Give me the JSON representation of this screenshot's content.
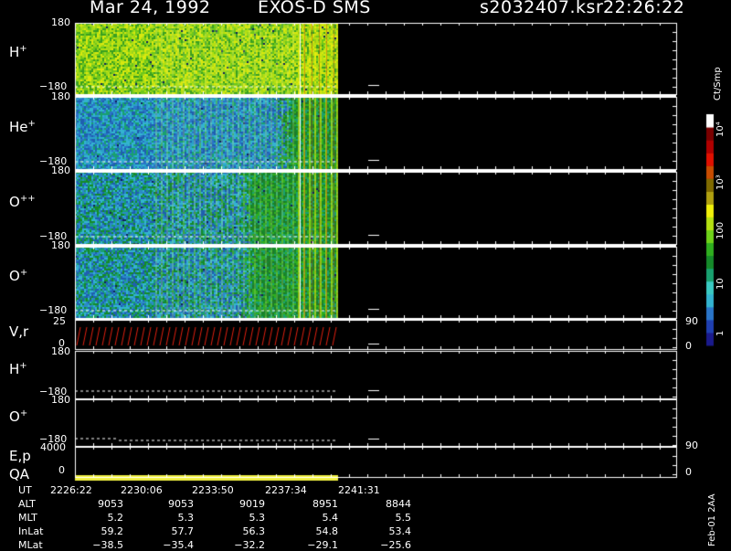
{
  "header": {
    "date": "Mar 24, 1992",
    "mission": "EXOS-D SMS",
    "file": "s2032407.ksr",
    "time": "22:26:22"
  },
  "panels": [
    {
      "id": "h",
      "label": "H",
      "sup": "+",
      "ytop": "180",
      "ybottom": "−180"
    },
    {
      "id": "he",
      "label": "He",
      "sup": "+",
      "ytop": "180",
      "ybottom": "−180"
    },
    {
      "id": "opp",
      "label": "O",
      "sup": "++",
      "ytop": "180",
      "ybottom": "−180"
    },
    {
      "id": "op",
      "label": "O",
      "sup": "+",
      "ytop": "180",
      "ybottom": "−180"
    },
    {
      "id": "vr",
      "label": "V,r",
      "sup": "",
      "ytop": "25",
      "ybottom": "0",
      "right_top": "90",
      "right_bottom": "0"
    },
    {
      "id": "h2",
      "label": "H",
      "sup": "+",
      "ytop": "180",
      "ybottom": "−180"
    },
    {
      "id": "o2",
      "label": "O",
      "sup": "+",
      "ytop": "180",
      "ybottom": "−180"
    },
    {
      "id": "ep",
      "label": "E,p",
      "sup": "",
      "ytop": "4000",
      "ybottom": "0",
      "right_top": "90",
      "right_bottom": "0"
    }
  ],
  "qa_label": "QA",
  "colorbar": {
    "unit": "Ct/Smp",
    "ticks": [
      {
        "label": "10⁴",
        "level": 1.0
      },
      {
        "label": "10³",
        "level": 0.75
      },
      {
        "label": "100",
        "level": 0.5
      },
      {
        "label": "10",
        "level": 0.25
      },
      {
        "label": "1",
        "level": 0.0
      }
    ],
    "colors": [
      "#1a1a8c",
      "#1f3fb0",
      "#2a75c8",
      "#33b3d0",
      "#3ac9c2",
      "#19a070",
      "#158a2a",
      "#2fae1f",
      "#6fd21a",
      "#b4e012",
      "#f0f00a",
      "#b0a010",
      "#806b00",
      "#c84c00",
      "#e01000",
      "#b00000",
      "#7a0000",
      "#ffffff"
    ]
  },
  "footer_table": {
    "rows": [
      {
        "label": "UT",
        "values": [
          "2226:22",
          "2230:06",
          "2233:50",
          "2237:34",
          "2241:31"
        ]
      },
      {
        "label": "ALT",
        "values": [
          "9053",
          "9053",
          "9019",
          "8951",
          "8844"
        ]
      },
      {
        "label": "MLT",
        "values": [
          "5.2",
          "5.3",
          "5.3",
          "5.4",
          "5.5"
        ]
      },
      {
        "label": "InLat",
        "values": [
          "59.2",
          "57.7",
          "56.3",
          "54.8",
          "53.4"
        ]
      },
      {
        "label": "MLat",
        "values": [
          "−38.5",
          "−35.4",
          "−32.2",
          "−29.1",
          "−25.6"
        ]
      }
    ]
  },
  "version_note": "Feb-01 2AA"
}
